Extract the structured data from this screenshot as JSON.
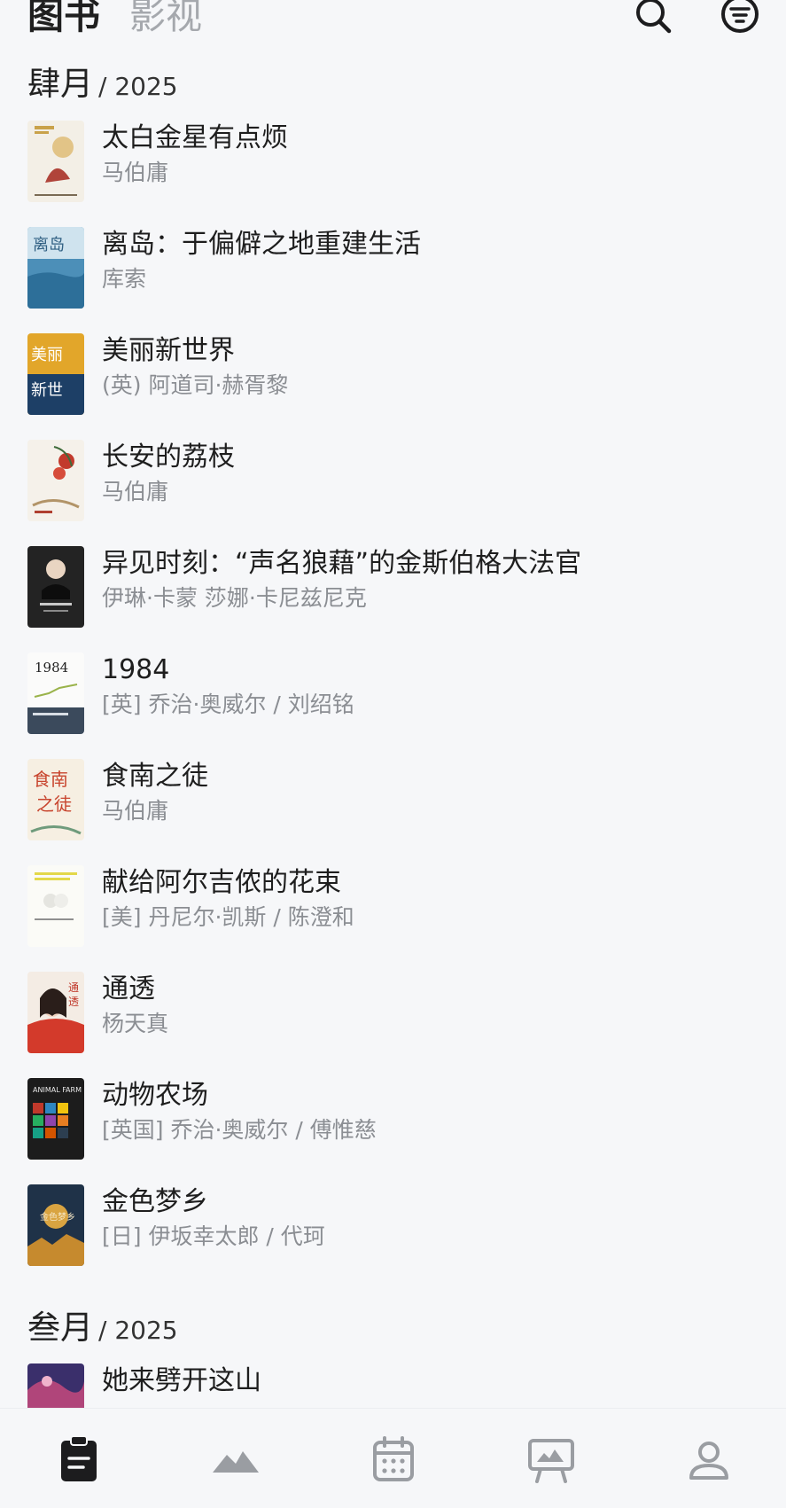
{
  "header": {
    "tab_books": "图书",
    "tab_films": "影视",
    "search_icon": "search-icon",
    "filter_icon": "filter-icon"
  },
  "sections": [
    {
      "month": "肆月",
      "year": "/ 2025",
      "books": [
        {
          "title": "太白金星有点烦",
          "author": "马伯庸"
        },
        {
          "title": "离岛：于偏僻之地重建生活",
          "author": "库索"
        },
        {
          "title": "美丽新世界",
          "author": "(英) 阿道司·赫胥黎"
        },
        {
          "title": "长安的荔枝",
          "author": "马伯庸"
        },
        {
          "title": "异见时刻：“声名狼藉”的金斯伯格大法官",
          "author": "伊琳·卡蒙 莎娜·卡尼兹尼克"
        },
        {
          "title": "1984",
          "author": "[英] 乔治·奥威尔 / 刘绍铭"
        },
        {
          "title": "食南之徒",
          "author": "马伯庸"
        },
        {
          "title": "献给阿尔吉侬的花束",
          "author": "[美] 丹尼尔·凯斯 / 陈澄和"
        },
        {
          "title": "通透",
          "author": "杨天真"
        },
        {
          "title": "动物农场",
          "author": "[英国] 乔治·奥威尔 / 傅惟慈"
        },
        {
          "title": "金色梦乡",
          "author": "[日] 伊坂幸太郎 / 代珂"
        }
      ]
    },
    {
      "month": "叁月",
      "year": "/ 2025",
      "books": [
        {
          "title": "她来劈开这山",
          "author": ""
        }
      ]
    }
  ],
  "bottom_nav": [
    {
      "icon": "clipboard-icon",
      "active": true
    },
    {
      "icon": "mountain-icon",
      "active": false
    },
    {
      "icon": "calendar-icon",
      "active": false
    },
    {
      "icon": "billboard-icon",
      "active": false
    },
    {
      "icon": "profile-icon",
      "active": false
    }
  ],
  "colors": {
    "background": "#f6f7f9",
    "text_primary": "#1e1e1e",
    "text_secondary": "#8b8e93",
    "tab_inactive": "#a5a8ad",
    "icon_inactive": "#9a9da2"
  }
}
